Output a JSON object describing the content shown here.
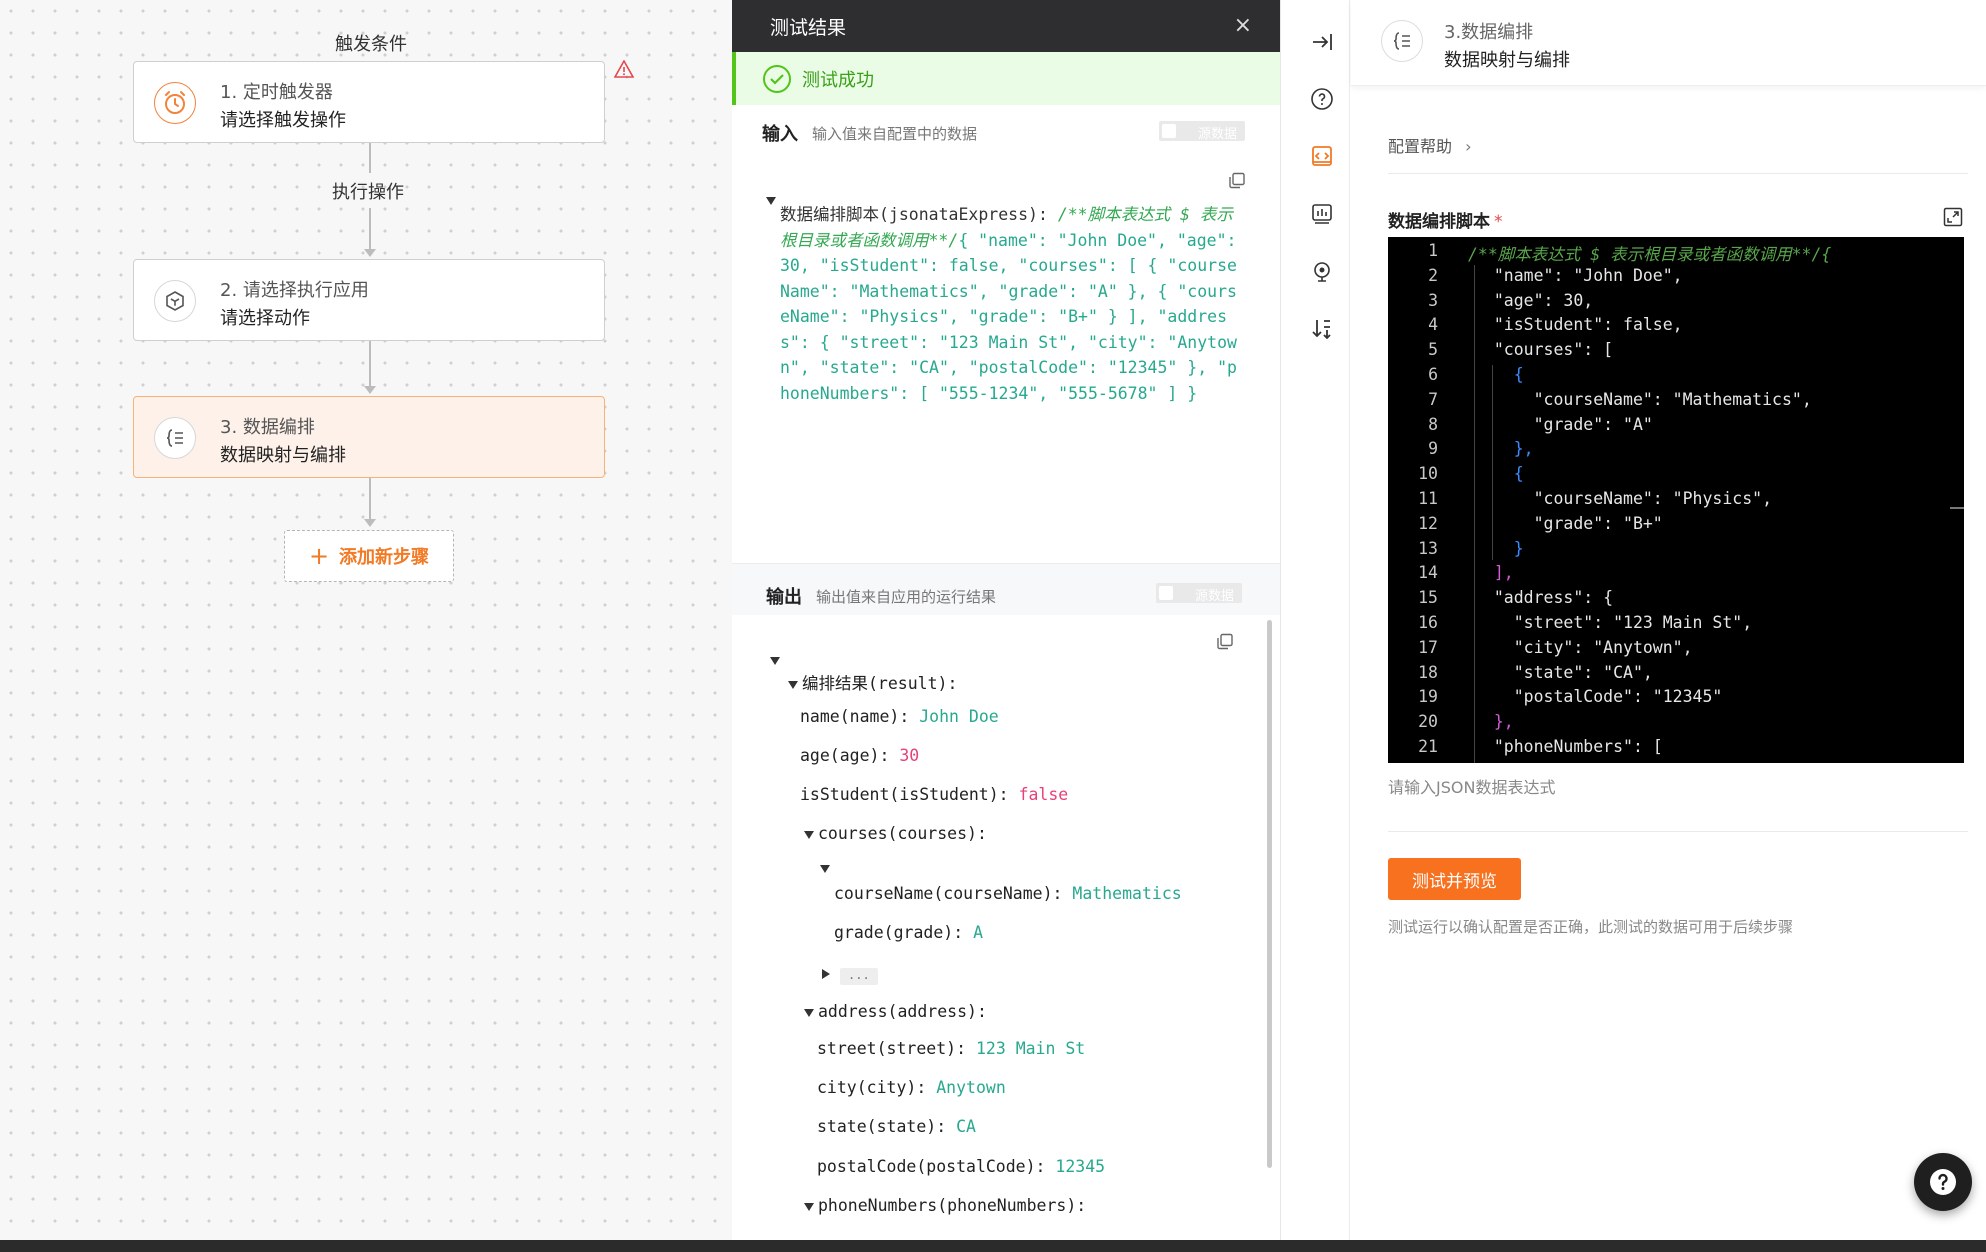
{
  "canvas": {
    "trigger_label": "触发条件",
    "action_label": "执行操作",
    "nodes": [
      {
        "title": "1. 定时触发器",
        "subtitle": "请选择触发操作"
      },
      {
        "title": "2. 请选择执行应用",
        "subtitle": "请选择动作"
      },
      {
        "title": "3. 数据编排",
        "subtitle": "数据映射与编排"
      }
    ],
    "add_step": "添加新步骤"
  },
  "test_panel": {
    "title": "测试结果",
    "status": "测试成功",
    "input_title": "输入",
    "input_sub": "输入值来自配置中的数据",
    "raw_toggle": "源数据",
    "input_key": "数据编排脚本(jsonataExpress): ",
    "input_comment": "/**脚本表达式 $ 表示根目录或者函数调用**/",
    "input_value": "{ \"name\": \"John Doe\", \"age\": 30, \"isStudent\": false, \"courses\": [ { \"courseName\": \"Mathematics\", \"grade\": \"A\" }, { \"courseName\": \"Physics\", \"grade\": \"B+\" } ], \"address\": { \"street\": \"123 Main St\", \"city\": \"Anytown\", \"state\": \"CA\", \"postalCode\": \"12345\" }, \"phoneNumbers\": [ \"555-1234\", \"555-5678\" ] }",
    "output_title": "输出",
    "output_sub": "输出值来自应用的运行结果",
    "output": {
      "result_key": "编排结果(result):",
      "name_key": "name(name):",
      "name_val": "John Doe",
      "age_key": "age(age):",
      "age_val": "30",
      "student_key": "isStudent(isStudent):",
      "student_val": "false",
      "courses_key": "courses(courses):",
      "course_name_key": "courseName(courseName):",
      "course_name_val": "Mathematics",
      "grade_key": "grade(grade):",
      "grade_val": "A",
      "ellipsis": "...",
      "address_key": "address(address):",
      "street_key": "street(street):",
      "street_val": "123 Main St",
      "city_key": "city(city):",
      "city_val": "Anytown",
      "state_key": "state(state):",
      "state_val": "CA",
      "postal_key": "postalCode(postalCode):",
      "postal_val": "12345",
      "phones_key": "phoneNumbers(phoneNumbers):"
    }
  },
  "rail": {
    "icons": [
      "collapse-right-icon",
      "help-circle-icon",
      "code-icon",
      "chart-icon",
      "location-icon",
      "sort-icon"
    ],
    "active_icon": "code-icon"
  },
  "config": {
    "step_name": "3.数据编排",
    "step_desc": "数据映射与编排",
    "help_link": "配置帮助",
    "script_label": "数据编排脚本",
    "required_mark": "*",
    "editor_lines": [
      "/**脚本表达式 $ 表示根目录或者函数调用**/{",
      "  \"name\": \"John Doe\",",
      "  \"age\": 30,",
      "  \"isStudent\": false,",
      "  \"courses\": [",
      "    {",
      "      \"courseName\": \"Mathematics\",",
      "      \"grade\": \"A\"",
      "    },",
      "    {",
      "      \"courseName\": \"Physics\",",
      "      \"grade\": \"B+\"",
      "    }",
      "  ],",
      "  \"address\": {",
      "    \"street\": \"123 Main St\",",
      "    \"city\": \"Anytown\",",
      "    \"state\": \"CA\",",
      "    \"postalCode\": \"12345\"",
      "  },",
      "  \"phoneNumbers\": ["
    ],
    "json_hint": "请输入JSON数据表达式",
    "test_button": "测试并预览",
    "test_note": "测试运行以确认配置是否正确，此测试的数据可用于后续步骤"
  },
  "colors": {
    "accent": "#f7711f",
    "success": "#52c41a",
    "editor_bg": "#000000"
  }
}
